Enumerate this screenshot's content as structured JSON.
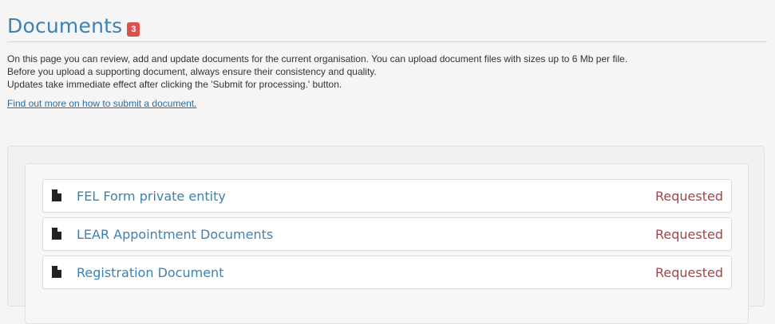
{
  "page": {
    "title": "Documents",
    "badge_count": "3",
    "intro_lines": [
      "On this page you can review, add and update documents for the current organisation. You can upload document files with sizes up to 6 Mb per file.",
      "Before you upload a supporting document, always ensure their consistency and quality.",
      "Updates take immediate effect after clicking the 'Submit for processing.' button."
    ],
    "help_link": "Find out more on how to submit a document."
  },
  "documents": [
    {
      "name": "FEL Form private entity",
      "status": "Requested",
      "icon": "document-icon"
    },
    {
      "name": "LEAR Appointment Documents",
      "status": "Requested",
      "icon": "document-icon"
    },
    {
      "name": "Registration Document",
      "status": "Requested",
      "icon": "document-icon"
    }
  ],
  "colors": {
    "title": "#3b82b5",
    "badge": "#d9534f",
    "link": "#2d6ca2",
    "status_requested": "#a94442"
  }
}
